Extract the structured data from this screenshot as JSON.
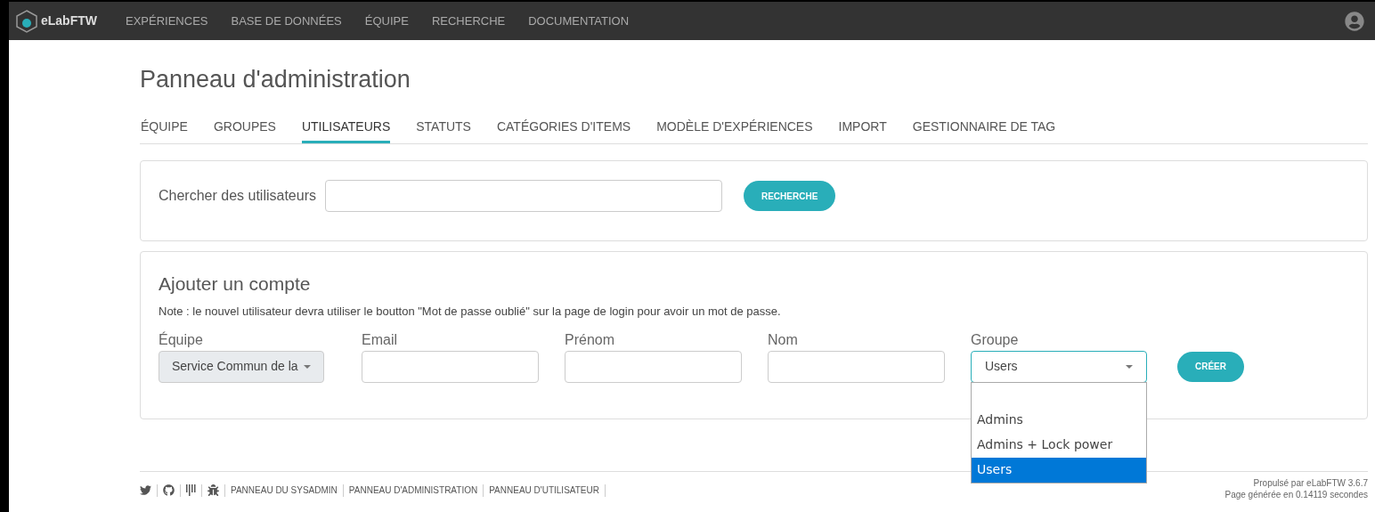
{
  "navbar": {
    "brand": "eLabFTW",
    "links": [
      "EXPÉRIENCES",
      "BASE DE DONNÉES",
      "ÉQUIPE",
      "RECHERCHE",
      "DOCUMENTATION"
    ]
  },
  "page_title": "Panneau d'administration",
  "tabs": [
    {
      "label": "ÉQUIPE",
      "selected": false
    },
    {
      "label": "GROUPES",
      "selected": false
    },
    {
      "label": "UTILISATEURS",
      "selected": true
    },
    {
      "label": "STATUTS",
      "selected": false
    },
    {
      "label": "CATÉGORIES D'ITEMS",
      "selected": false
    },
    {
      "label": "MODÈLE D'EXPÉRIENCES",
      "selected": false
    },
    {
      "label": "IMPORT",
      "selected": false
    },
    {
      "label": "GESTIONNAIRE DE TAG",
      "selected": false
    }
  ],
  "search": {
    "label": "Chercher des utilisateurs",
    "button": "RECHERCHE"
  },
  "add_account": {
    "title": "Ajouter un compte",
    "note": "Note : le nouvel utilisateur devra utiliser le boutton \"Mot de passe oublié\" sur la page de login pour avoir un mot de passe.",
    "team": {
      "label": "Équipe",
      "value": "Service Commun de la"
    },
    "fields": [
      {
        "label": "Email"
      },
      {
        "label": "Prénom"
      },
      {
        "label": "Nom"
      }
    ],
    "group": {
      "label": "Groupe",
      "value": "Users",
      "expanded": true,
      "options": [
        {
          "label": "Admins",
          "selected": false
        },
        {
          "label": "Admins + Lock power",
          "selected": false
        },
        {
          "label": "Users",
          "selected": true
        }
      ]
    },
    "button": "CRÉER"
  },
  "footer": {
    "links": [
      "PANNEAU DU SYSADMIN",
      "PANNEAU D'ADMINISTRATION",
      "PANNEAU D'UTILISATEUR"
    ],
    "powered": "Propulsé par eLabFTW 3.6.7",
    "generated": "Page générée en 0.14119 secondes"
  }
}
